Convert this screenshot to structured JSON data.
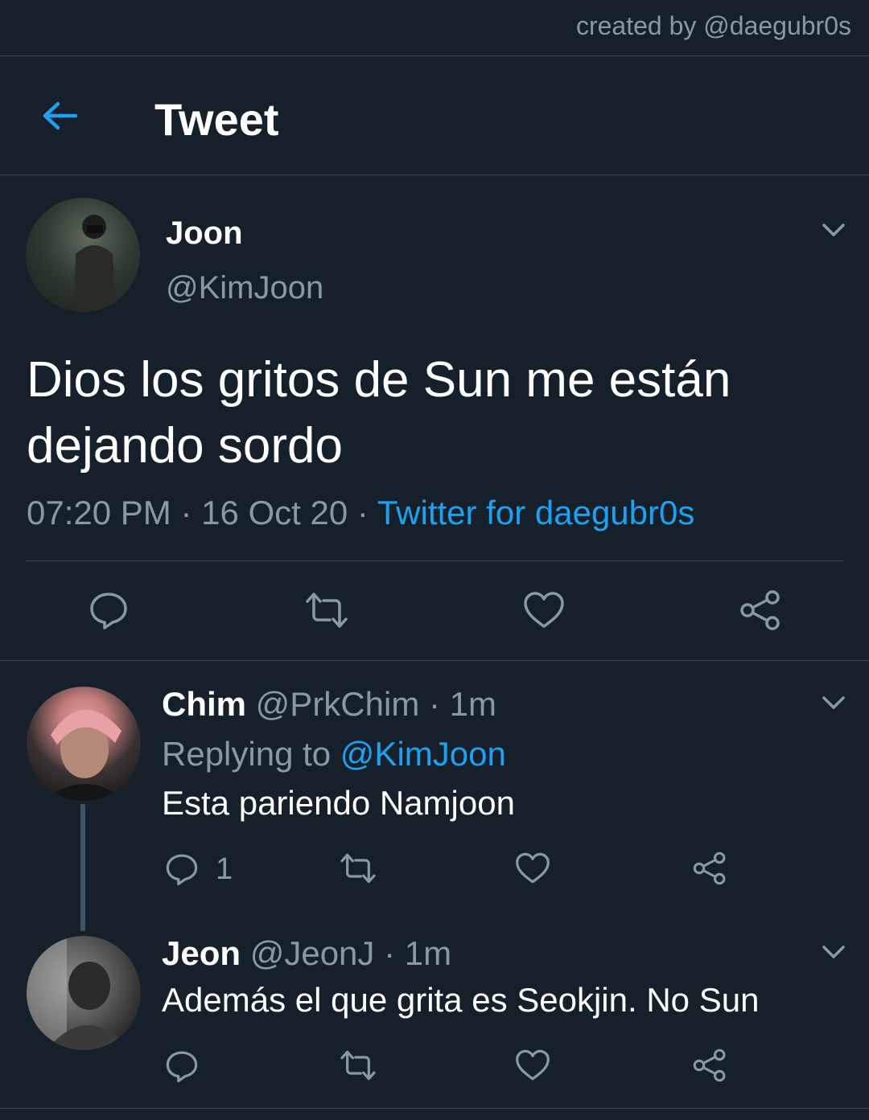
{
  "watermark": "created by @daegubr0s",
  "header": {
    "title": "Tweet",
    "back_icon": "arrow-left-icon"
  },
  "colors": {
    "background": "#15202b",
    "accent": "#1da1f2",
    "muted": "#8899a6",
    "border": "#38444d"
  },
  "main_tweet": {
    "name": "Joon",
    "handle": "@KimJoon",
    "text": "Dios los gritos de Sun me están dejando sordo",
    "time": "07:20 PM",
    "date": "16 Oct 20",
    "separator": "·",
    "source": "Twitter for daegubr0s",
    "actions": [
      "reply-icon",
      "retweet-icon",
      "like-icon",
      "share-icon"
    ]
  },
  "replies": [
    {
      "name": "Chim",
      "handle": "@PrkChim",
      "separator": "·",
      "time": "1m",
      "replying_label": "Replying to",
      "replying_to": "@KimJoon",
      "text": "Esta pariendo Namjoon",
      "reply_count": "1"
    },
    {
      "name": "Jeon",
      "handle": "@JeonJ",
      "separator": "·",
      "time": "1m",
      "text": "Además el que grita es Seokjin. No Sun"
    }
  ]
}
